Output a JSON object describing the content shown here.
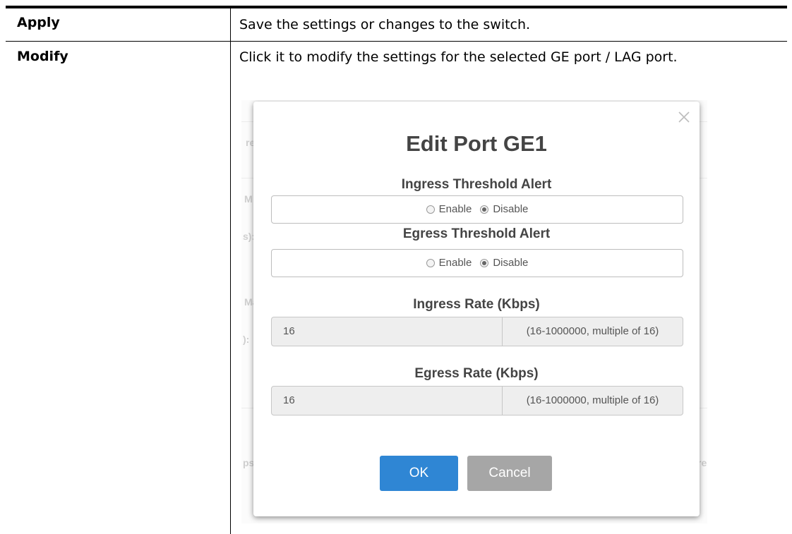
{
  "rows": [
    {
      "name": "Apply",
      "description": "Save the settings or changes to the switch."
    },
    {
      "name": "Modify",
      "description": "Click it to modify the settings for the selected GE port / LAG port."
    }
  ],
  "background_fragments": [
    "re",
    "M",
    "s):",
    "Ma",
    "):",
    "ps",
    "re"
  ],
  "modal": {
    "title": "Edit Port GE1",
    "ingress_alert": {
      "label": "Ingress Threshold Alert",
      "enable_label": "Enable",
      "disable_label": "Disable",
      "selected": "Disable"
    },
    "egress_alert": {
      "label": "Egress Threshold Alert",
      "enable_label": "Enable",
      "disable_label": "Disable",
      "selected": "Disable"
    },
    "ingress_rate": {
      "label": "Ingress Rate (Kbps)",
      "value": "16",
      "hint": "(16-1000000, multiple of 16)"
    },
    "egress_rate": {
      "label": "Egress Rate (Kbps)",
      "value": "16",
      "hint": "(16-1000000, multiple of 16)"
    },
    "ok_label": "OK",
    "cancel_label": "Cancel",
    "colors": {
      "ok": "#2f86d4",
      "cancel": "#a6a6a6",
      "title": "#444444"
    }
  }
}
